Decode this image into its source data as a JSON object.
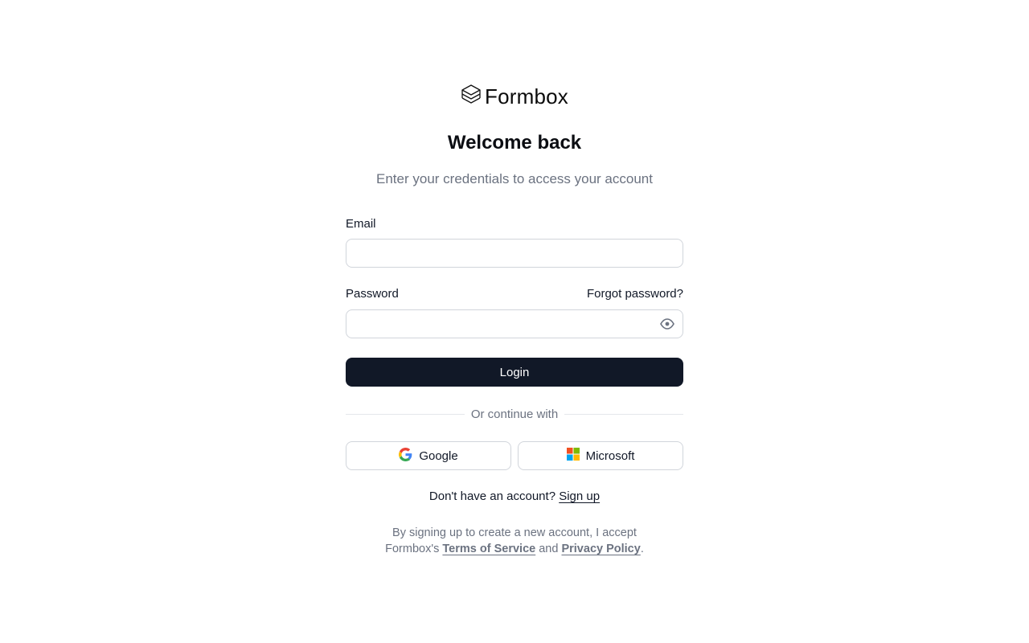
{
  "brand": {
    "name": "Formbox",
    "icon": "layers-icon"
  },
  "heading": {
    "title": "Welcome back",
    "subtitle": "Enter your credentials to access your account"
  },
  "form": {
    "email_label": "Email",
    "email_value": "",
    "password_label": "Password",
    "password_value": "",
    "forgot_label": "Forgot password?",
    "show_password_icon": "eye-icon",
    "login_label": "Login"
  },
  "divider": {
    "label": "Or continue with"
  },
  "social": {
    "google_label": "Google",
    "microsoft_label": "Microsoft"
  },
  "signup": {
    "prompt": "Don't have an account?",
    "link": "Sign up"
  },
  "legal": {
    "line1": "By signing up to create a new account, I accept",
    "prefix": "Formbox's",
    "terms": "Terms of Service",
    "and": "and",
    "privacy": "Privacy Policy",
    "suffix": "."
  },
  "colors": {
    "primary": "#111827",
    "muted_text": "#6b7280",
    "border": "#d1d5db",
    "google_blue": "#4285F4",
    "google_red": "#EA4335",
    "google_yellow": "#FBBC05",
    "google_green": "#34A853",
    "ms_red": "#F25022",
    "ms_green": "#7FBA00",
    "ms_blue": "#00A4EF",
    "ms_yellow": "#FFB900"
  }
}
